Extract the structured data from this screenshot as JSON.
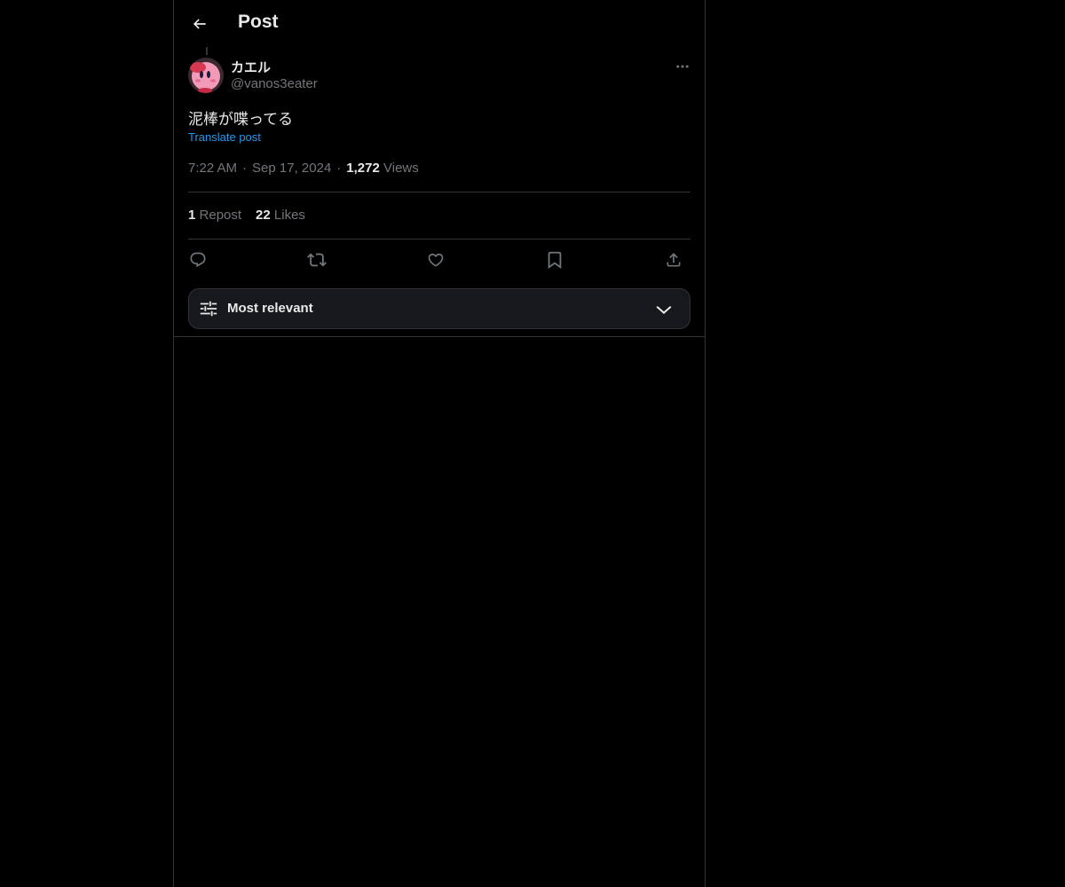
{
  "header": {
    "title": "Post",
    "back_icon": "arrow-left-icon"
  },
  "post": {
    "author": {
      "display_name": "カエル",
      "handle": "@vanos3eater",
      "avatar": "pink-character-avatar"
    },
    "text": "泥棒が喋ってる",
    "translate_label": "Translate post",
    "time": "7:22 AM",
    "separator": "·",
    "date": "Sep 17, 2024",
    "views_count": "1,272",
    "views_label": "Views",
    "stats": {
      "reposts_count": "1",
      "reposts_label": "Repost",
      "likes_count": "22",
      "likes_label": "Likes"
    }
  },
  "actions": {
    "reply_icon": "reply-icon",
    "repost_icon": "repost-icon",
    "like_icon": "heart-icon",
    "bookmark_icon": "bookmark-icon",
    "share_icon": "share-icon"
  },
  "replies_sort": {
    "label": "Most relevant",
    "icon": "sliders-icon",
    "dropdown_icon": "chevron-down-icon"
  },
  "colors": {
    "background": "#000000",
    "text": "#e7e9ea",
    "secondary_text": "#71767b",
    "link": "#1d9bf0",
    "border": "#2f3336"
  }
}
